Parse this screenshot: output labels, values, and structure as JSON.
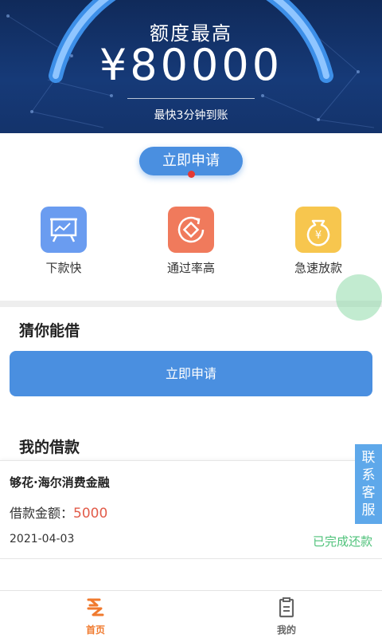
{
  "banner": {
    "title": "额度最高",
    "amount": "¥80000",
    "subtitle": "最快3分钟到账"
  },
  "apply_pill_label": "立即申请",
  "features": [
    {
      "label": "下款快",
      "icon": "chart-board-icon",
      "color": "#6a9cf0"
    },
    {
      "label": "通过率高",
      "icon": "refresh-diamond-icon",
      "color": "#f07a5c"
    },
    {
      "label": "急速放款",
      "icon": "yen-bag-icon",
      "color": "#f7c64e"
    }
  ],
  "guess_section": {
    "title": "猜你能借",
    "button_label": "立即申请"
  },
  "my_loans": {
    "title": "我的借款",
    "items": [
      {
        "name": "够花·海尔消费金融",
        "amount_label": "借款金额：",
        "amount": "5000",
        "date": "2021-04-03",
        "status": "已完成还款"
      }
    ]
  },
  "service_tab": [
    "联",
    "系",
    "客",
    "服"
  ],
  "bottom_nav": {
    "home": "首页",
    "mine": "我的"
  },
  "colors": {
    "accent": "#4a8fe0",
    "home_active": "#f07a2e",
    "status_done": "#4fc27a",
    "amount_red": "#e25c4a"
  }
}
